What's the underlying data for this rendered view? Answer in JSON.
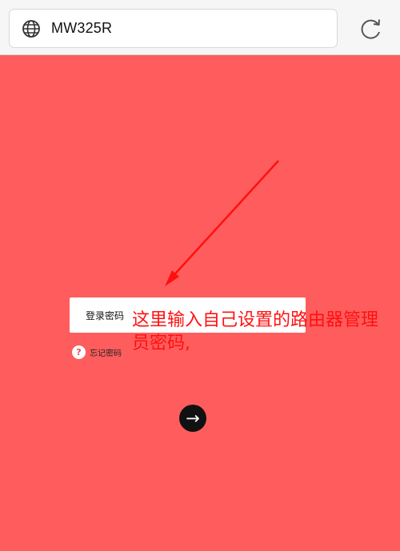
{
  "browser": {
    "url": "MW325R",
    "icons": {
      "globe": "globe-icon",
      "reload": "reload-icon"
    }
  },
  "login": {
    "password_placeholder": "登录密码",
    "forgot_label": "忘记密码",
    "forgot_icon": "?",
    "submit_icon": "→"
  },
  "annotation": {
    "text": "这里输入自己设置的路由器管理员密码,",
    "color": "#ff1010"
  },
  "colors": {
    "background": "#ff5d5d",
    "topbar": "#f6f6f6"
  }
}
